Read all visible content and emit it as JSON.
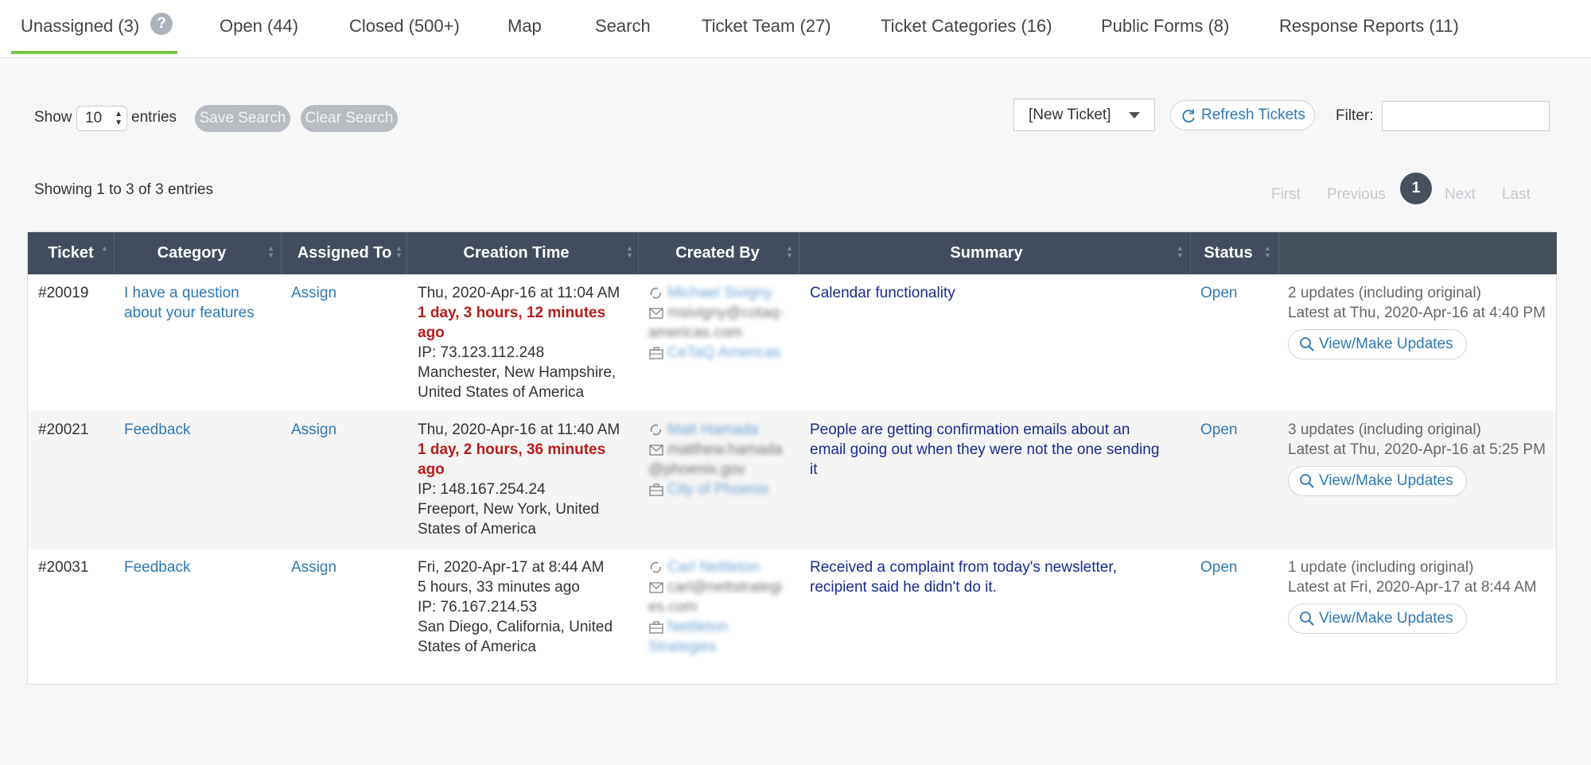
{
  "tabs": [
    {
      "label": "Unassigned (3)",
      "active": true
    },
    {
      "label": "Open (44)"
    },
    {
      "label": "Closed (500+)"
    },
    {
      "label": "Map"
    },
    {
      "label": "Search"
    },
    {
      "label": "Ticket Team (27)"
    },
    {
      "label": "Ticket Categories (16)"
    },
    {
      "label": "Public Forms (8)"
    },
    {
      "label": "Response Reports (11)"
    }
  ],
  "help_icon": "?",
  "controls": {
    "show_label": "Show",
    "entries_value": "10",
    "entries_label": "entries",
    "save_search": "Save Search",
    "clear_search": "Clear Search",
    "new_ticket": "[New Ticket]",
    "refresh": "Refresh Tickets",
    "filter_label": "Filter:",
    "filter_value": ""
  },
  "info": "Showing 1 to 3 of 3 entries",
  "pagination": {
    "first": "First",
    "previous": "Previous",
    "current": "1",
    "next": "Next",
    "last": "Last"
  },
  "columns": [
    "Ticket",
    "Category",
    "Assigned To",
    "Creation Time",
    "Created By",
    "Summary",
    "Status"
  ],
  "rows": [
    {
      "ticket": "#20019",
      "category": [
        "I have a question",
        "about your features"
      ],
      "assigned": "Assign",
      "time": "Thu, 2020-Apr-16 at 11:04 AM",
      "age": [
        "1 day, 3 hours, 12 minutes",
        "ago"
      ],
      "age_overdue": true,
      "ip": "IP: 73.123.112.248",
      "location": [
        "Manchester, New Hampshire,",
        "United States of America"
      ],
      "created_name": "Michael Sivigny",
      "created_email": [
        "msivigny@cotaq-",
        "americas.com"
      ],
      "created_org": "CeTaQ Americas",
      "summary": [
        "Calendar functionality"
      ],
      "status": "Open",
      "updates": "2 updates (including original)",
      "latest": "Latest at Thu, 2020-Apr-16 at 4:40 PM",
      "button": "View/Make Updates"
    },
    {
      "ticket": "#20021",
      "category": [
        "Feedback"
      ],
      "assigned": "Assign",
      "time": "Thu, 2020-Apr-16 at 11:40 AM",
      "age": [
        "1 day, 2 hours, 36 minutes",
        "ago"
      ],
      "age_overdue": true,
      "ip": "IP: 148.167.254.24",
      "location": [
        "Freeport, New York, United",
        "States of America"
      ],
      "created_name": "Matt Hamada",
      "created_email": [
        "matthew.hamada",
        "@phoenix.gov"
      ],
      "created_org": "City of Phoenix",
      "summary": [
        "People are getting confirmation emails about an",
        "email going out when they were not the one sending",
        "it"
      ],
      "status": "Open",
      "updates": "3 updates (including original)",
      "latest": "Latest at Thu, 2020-Apr-16 at 5:25 PM",
      "button": "View/Make Updates"
    },
    {
      "ticket": "#20031",
      "category": [
        "Feedback"
      ],
      "assigned": "Assign",
      "time": "Fri, 2020-Apr-17 at 8:44 AM",
      "age": [
        "5 hours, 33 minutes ago"
      ],
      "age_overdue": false,
      "ip": "IP: 76.167.214.53",
      "location": [
        "San Diego, California, United",
        "States of America"
      ],
      "created_name": "Carl Nettleton",
      "created_email": [
        "carl@nettstrategi",
        "es.com"
      ],
      "created_org": [
        "Nettleton",
        "Strategies"
      ],
      "summary": [
        "Received a complaint from today's newsletter,",
        "recipient said he didn't do it."
      ],
      "status": "Open",
      "updates": "1 update (including original)",
      "latest": "Latest at Fri, 2020-Apr-17 at 8:44 AM",
      "button": "View/Make Updates"
    }
  ],
  "colors": {
    "tab_active": "#7dc243",
    "header_bg": "#414d5e",
    "link": "#2f78b5",
    "overdue": "#b81c1c"
  },
  "icons": [
    "help-icon",
    "refresh-icon",
    "dropdown-caret-icon",
    "sort-icon",
    "phone-icon",
    "envelope-icon",
    "briefcase-icon",
    "magnifier-icon"
  ]
}
